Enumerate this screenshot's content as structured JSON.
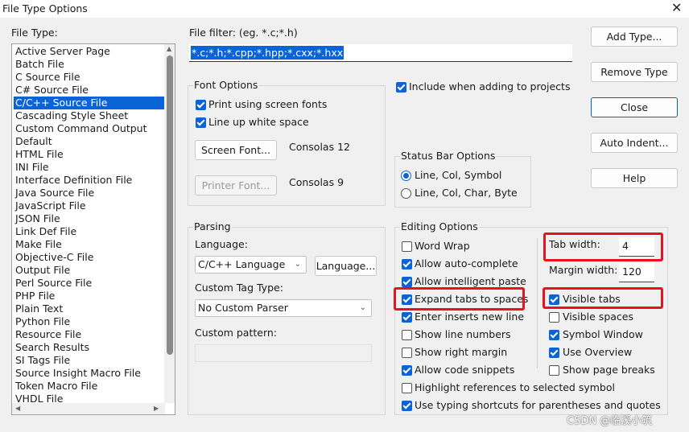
{
  "window": {
    "title": "File Type Options",
    "close_symbol": "✕"
  },
  "file_type": {
    "label": "File Type:",
    "items": [
      "Active Server Page",
      "Batch File",
      "C Source File",
      "C# Source File",
      "C/C++ Source File",
      "Cascading Style Sheet",
      "Custom Command Output",
      "Default",
      "HTML File",
      "INI File",
      "Interface Definition File",
      "Java Source File",
      "JavaScript File",
      "JSON File",
      "Link Def File",
      "Make File",
      "Objective-C File",
      "Output File",
      "Perl Source File",
      "PHP File",
      "Plain Text",
      "Python File",
      "Resource File",
      "Search Results",
      "SI Tags File",
      "Source Insight Macro File",
      "Token Macro File",
      "VHDL File"
    ],
    "selected_index": 4
  },
  "file_filter": {
    "label": "File filter: (eg. *.c;*.h)",
    "value": "*.c;*.h;*.cpp;*.hpp;*.cxx;*.hxx"
  },
  "buttons": {
    "add_type": "Add Type...",
    "remove_type": "Remove Type",
    "close": "Close",
    "auto_indent": "Auto Indent...",
    "help": "Help"
  },
  "include_when_adding": {
    "label": "Include when adding to projects",
    "checked": true
  },
  "font_options": {
    "title": "Font Options",
    "print_screen_fonts": {
      "label": "Print using screen fonts",
      "checked": true
    },
    "line_up_white_space": {
      "label": "Line up white space",
      "checked": true
    },
    "screen_font_button": "Screen Font...",
    "screen_font_value": "Consolas 12",
    "printer_font_button": "Printer Font...",
    "printer_font_value": "Consolas 9"
  },
  "status_bar_options": {
    "title": "Status Bar Options",
    "options": [
      "Line, Col, Symbol",
      "Line, Col, Char, Byte"
    ],
    "selected_index": 0
  },
  "parsing": {
    "title": "Parsing",
    "language_label": "Language:",
    "language_value": "C/C++ Language",
    "language_button": "Language...",
    "custom_tag_label": "Custom Tag Type:",
    "custom_tag_value": "No Custom Parser",
    "custom_pattern_label": "Custom pattern:",
    "custom_pattern_value": ""
  },
  "editing_options": {
    "title": "Editing Options",
    "word_wrap": {
      "label": "Word Wrap",
      "checked": false
    },
    "allow_auto_complete": {
      "label": "Allow auto-complete",
      "checked": true
    },
    "allow_intelligent_paste": {
      "label": "Allow intelligent paste",
      "checked": true
    },
    "expand_tabs": {
      "label": "Expand tabs to spaces",
      "checked": true
    },
    "enter_inserts_new_line": {
      "label": "Enter inserts new line",
      "checked": true
    },
    "show_line_numbers": {
      "label": "Show line numbers",
      "checked": false
    },
    "show_right_margin": {
      "label": "Show right margin",
      "checked": false
    },
    "allow_code_snippets": {
      "label": "Allow code snippets",
      "checked": true
    },
    "highlight_references": {
      "label": "Highlight references to selected symbol",
      "checked": false
    },
    "use_typing_shortcuts": {
      "label": "Use typing shortcuts for parentheses and quotes",
      "checked": true
    },
    "tab_width_label": "Tab width:",
    "tab_width_value": "4",
    "margin_width_label": "Margin width:",
    "margin_width_value": "120",
    "visible_tabs": {
      "label": "Visible tabs",
      "checked": true
    },
    "visible_spaces": {
      "label": "Visible spaces",
      "checked": false
    },
    "symbol_window": {
      "label": "Symbol Window",
      "checked": true
    },
    "use_overview": {
      "label": "Use Overview",
      "checked": true
    },
    "show_page_breaks": {
      "label": "Show page breaks",
      "checked": false
    }
  },
  "watermark": "CSDN @临溪小筑",
  "colors": {
    "accent": "#0a64d8",
    "highlight_box": "#e8121e"
  }
}
